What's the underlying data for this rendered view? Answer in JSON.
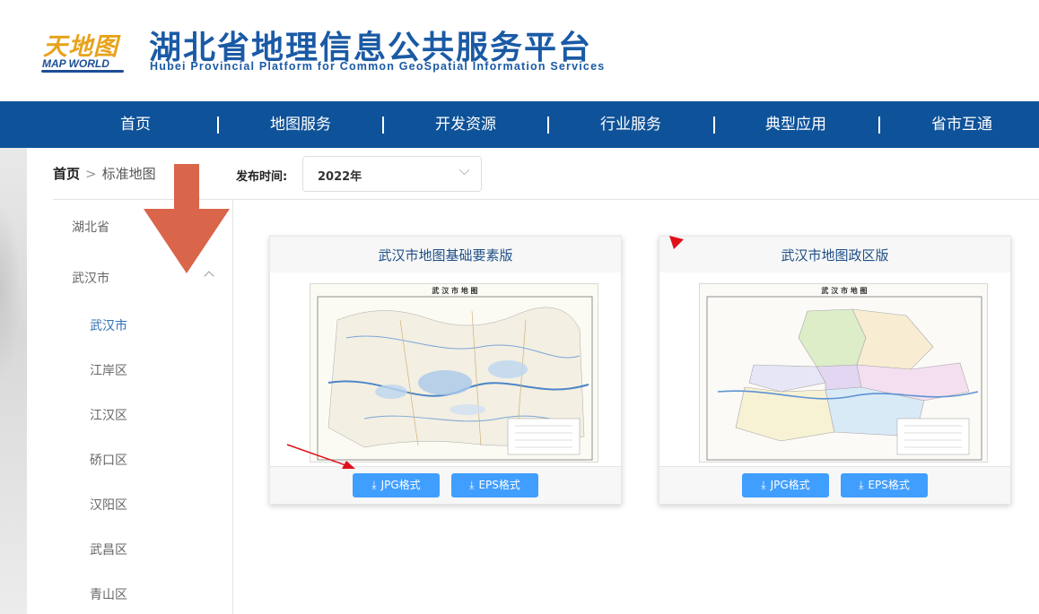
{
  "header": {
    "logo_cn": "天地图",
    "logo_en": "MAP WORLD",
    "title": "湖北省地理信息公共服务平台",
    "subtitle": "Hubei Provincial Platform for Common GeoSpatial Information Services"
  },
  "nav": {
    "items": [
      {
        "label": "首页"
      },
      {
        "label": "地图服务"
      },
      {
        "label": "开发资源"
      },
      {
        "label": "行业服务"
      },
      {
        "label": "典型应用"
      },
      {
        "label": "省市互通"
      }
    ],
    "color": "#0e5299"
  },
  "breadcrumb": {
    "home": "首页",
    "separator": ">",
    "current": "标准地图"
  },
  "filter": {
    "label": "发布时间:",
    "year_value": "2022年"
  },
  "sidebar": {
    "province": "湖北省",
    "city": "武汉市",
    "districts": [
      "武汉市",
      "江岸区",
      "江汉区",
      "硚口区",
      "汉阳区",
      "武昌区",
      "青山区"
    ],
    "active": "武汉市"
  },
  "cards": [
    {
      "title": "武汉市地图基础要素版",
      "map_header": "武 汉 市 地 图",
      "buttons": [
        "JPG格式",
        "EPS格式"
      ]
    },
    {
      "title": "武汉市地图政区版",
      "map_header": "武 汉 市 地 图",
      "buttons": [
        "JPG格式",
        "EPS格式"
      ]
    }
  ],
  "colors": {
    "accent": "#409eff",
    "title_blue": "#1a5aa5",
    "annotation_arrow": "#d9654a",
    "annotation_red": "#e0101a"
  }
}
